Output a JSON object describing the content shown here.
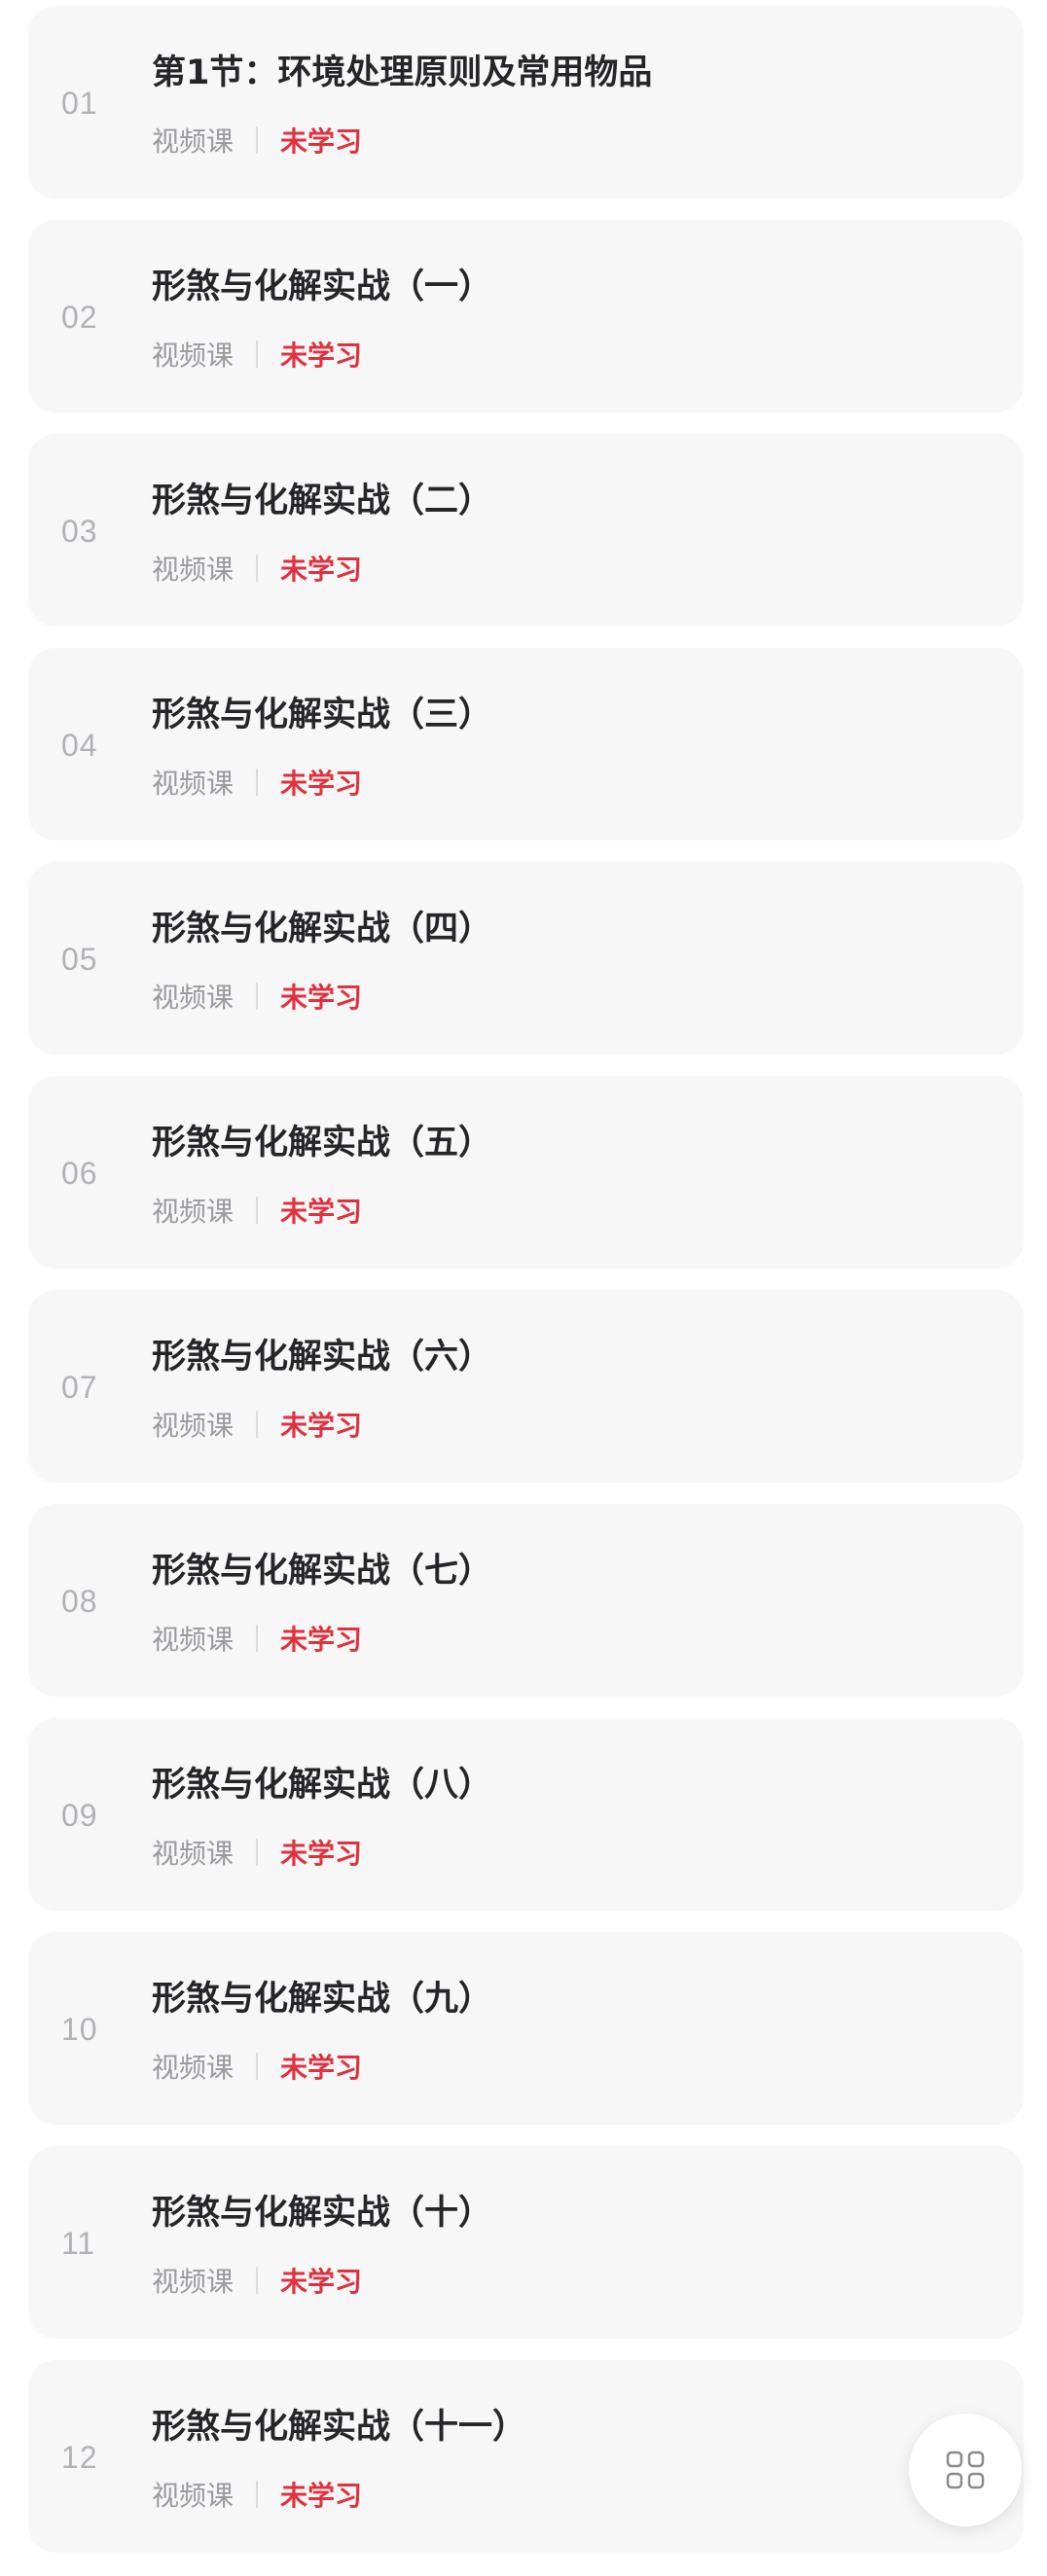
{
  "lessons": [
    {
      "num": "01",
      "title": "第1节：环境处理原则及常用物品",
      "type": "视频课",
      "status": "未学习"
    },
    {
      "num": "02",
      "title": "形煞与化解实战（一）",
      "type": "视频课",
      "status": "未学习"
    },
    {
      "num": "03",
      "title": "形煞与化解实战（二）",
      "type": "视频课",
      "status": "未学习"
    },
    {
      "num": "04",
      "title": "形煞与化解实战（三）",
      "type": "视频课",
      "status": "未学习"
    },
    {
      "num": "05",
      "title": "形煞与化解实战（四）",
      "type": "视频课",
      "status": "未学习"
    },
    {
      "num": "06",
      "title": "形煞与化解实战（五）",
      "type": "视频课",
      "status": "未学习"
    },
    {
      "num": "07",
      "title": "形煞与化解实战（六）",
      "type": "视频课",
      "status": "未学习"
    },
    {
      "num": "08",
      "title": "形煞与化解实战（七）",
      "type": "视频课",
      "status": "未学习"
    },
    {
      "num": "09",
      "title": "形煞与化解实战（八）",
      "type": "视频课",
      "status": "未学习"
    },
    {
      "num": "10",
      "title": "形煞与化解实战（九）",
      "type": "视频课",
      "status": "未学习"
    },
    {
      "num": "11",
      "title": "形煞与化解实战（十）",
      "type": "视频课",
      "status": "未学习"
    },
    {
      "num": "12",
      "title": "形煞与化解实战（十一）",
      "type": "视频课",
      "status": "未学习"
    }
  ],
  "fab": {
    "icon": "grid-icon"
  },
  "colors": {
    "status_unlearned": "#e0323e",
    "card_background": "#f7f7f8"
  }
}
